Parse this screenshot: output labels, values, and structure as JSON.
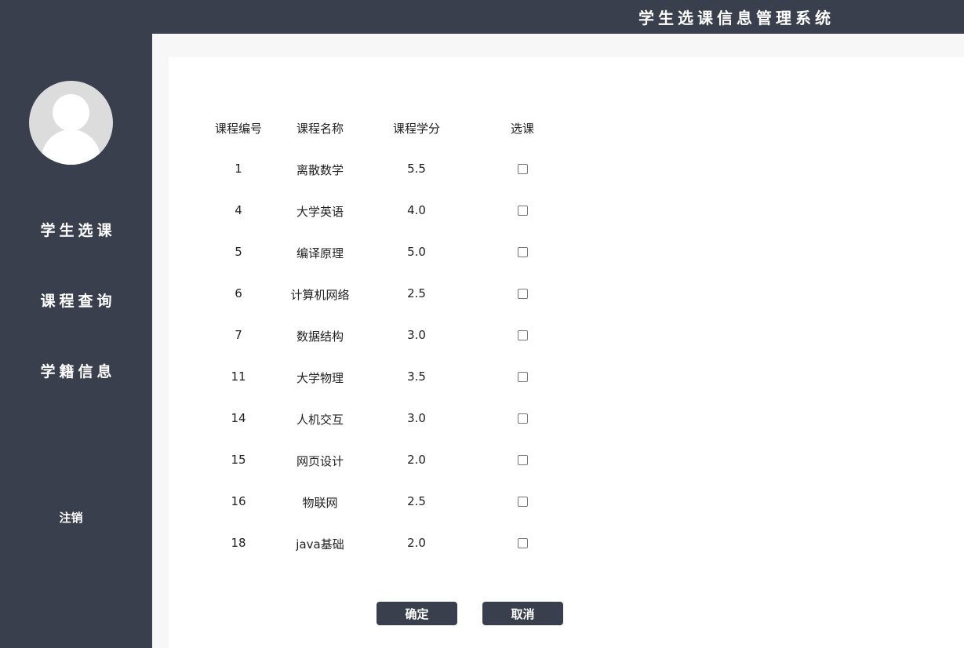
{
  "header": {
    "title": "学生选课信息管理系统"
  },
  "sidebar": {
    "nav": [
      "学生选课",
      "课程查询",
      "学籍信息"
    ],
    "logout": "注销"
  },
  "table": {
    "headers": [
      "课程编号",
      "课程名称",
      "课程学分",
      "选课"
    ],
    "rows": [
      {
        "id": "1",
        "name": "离散数学",
        "credit": "5.5",
        "selected": false
      },
      {
        "id": "4",
        "name": "大学英语",
        "credit": "4.0",
        "selected": false
      },
      {
        "id": "5",
        "name": "编译原理",
        "credit": "5.0",
        "selected": false
      },
      {
        "id": "6",
        "name": "计算机网络",
        "credit": "2.5",
        "selected": false
      },
      {
        "id": "7",
        "name": "数据结构",
        "credit": "3.0",
        "selected": false
      },
      {
        "id": "11",
        "name": "大学物理",
        "credit": "3.5",
        "selected": false
      },
      {
        "id": "14",
        "name": "人机交互",
        "credit": "3.0",
        "selected": false
      },
      {
        "id": "15",
        "name": "网页设计",
        "credit": "2.0",
        "selected": false
      },
      {
        "id": "16",
        "name": "物联网",
        "credit": "2.5",
        "selected": false
      },
      {
        "id": "18",
        "name": "java基础",
        "credit": "2.0",
        "selected": false
      }
    ]
  },
  "actions": {
    "confirm": "确定",
    "cancel": "取消"
  },
  "colors": {
    "dark": "#3a3f4d",
    "content_bg": "#f7f7f7",
    "panel": "#ffffff"
  }
}
